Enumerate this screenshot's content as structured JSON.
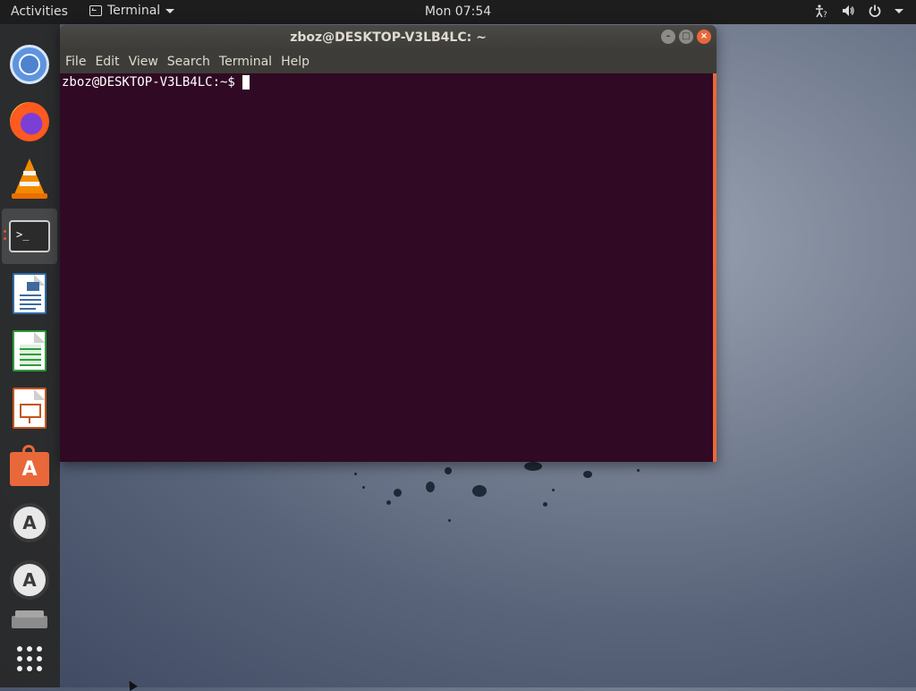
{
  "topbar": {
    "activities_label": "Activities",
    "app_name": "Terminal",
    "clock": "Mon 07:54",
    "tray_icons": [
      "accessibility-icon",
      "volume-icon",
      "power-icon",
      "chevron-down-icon"
    ]
  },
  "dock": {
    "items": [
      {
        "name": "chromium",
        "icon": "chromium-icon"
      },
      {
        "name": "firefox",
        "icon": "firefox-icon"
      },
      {
        "name": "vlc",
        "icon": "vlc-icon"
      },
      {
        "name": "terminal",
        "icon": "terminal-icon",
        "active": true
      },
      {
        "name": "libreoffice-writer",
        "icon": "writer-icon"
      },
      {
        "name": "libreoffice-calc",
        "icon": "calc-icon"
      },
      {
        "name": "libreoffice-impress",
        "icon": "impress-icon"
      },
      {
        "name": "ubuntu-software",
        "icon": "software-center-icon"
      },
      {
        "name": "software-updater",
        "icon": "software-updater-icon"
      },
      {
        "name": "software-updater-2",
        "icon": "software-updater-icon"
      },
      {
        "name": "drive",
        "icon": "drive-icon"
      },
      {
        "name": "show-applications",
        "icon": "app-grid-icon"
      }
    ],
    "updater_letter": "A",
    "store_letter": "A",
    "terminal_glyph": ">_"
  },
  "window": {
    "title": "zboz@DESKTOP-V3LB4LC: ~",
    "menu": [
      "File",
      "Edit",
      "View",
      "Search",
      "Terminal",
      "Help"
    ],
    "buttons": {
      "minimize": "–",
      "maximize": "□",
      "close": "×"
    }
  },
  "terminal": {
    "prompt": "zboz@DESKTOP-V3LB4LC:~$",
    "background": "#300a24",
    "foreground": "#ffffff"
  }
}
